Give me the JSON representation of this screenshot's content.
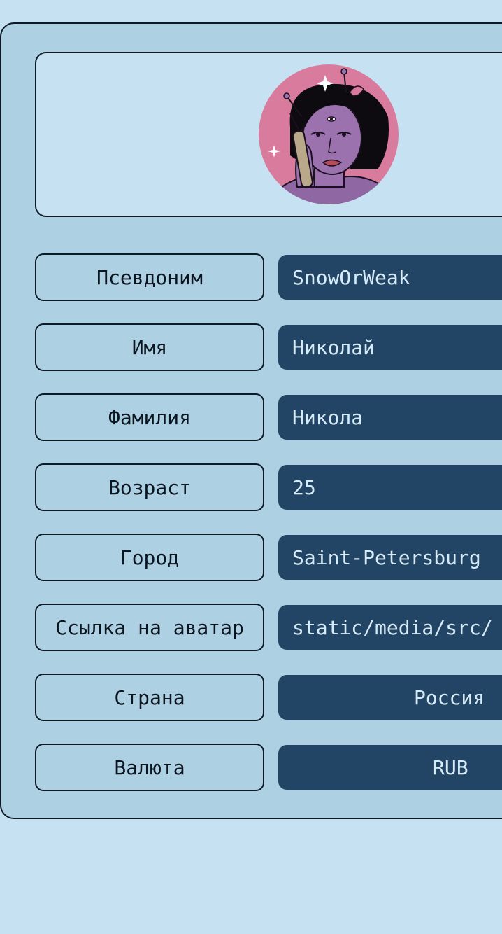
{
  "profile": {
    "fields": [
      {
        "label": "Псевдоним",
        "value": "SnowOrWeak"
      },
      {
        "label": "Имя",
        "value": "Николай"
      },
      {
        "label": "Фамилия",
        "value": "Никола"
      },
      {
        "label": "Возраст",
        "value": "25"
      },
      {
        "label": "Город",
        "value": "Saint-Petersburg"
      },
      {
        "label": "Ссылка на аватар",
        "value": "static/media/src/"
      },
      {
        "label": "Страна",
        "value": "Россия"
      },
      {
        "label": "Валюта",
        "value": "RUB"
      }
    ]
  },
  "colors": {
    "page_bg": "#c6e2f2",
    "panel_bg": "#add0e3",
    "field_bg": "#234565",
    "field_text": "#d6ebf7",
    "border": "#0c1a26",
    "avatar_bg": "#d97b9c",
    "avatar_skin": "#9b72ad"
  }
}
